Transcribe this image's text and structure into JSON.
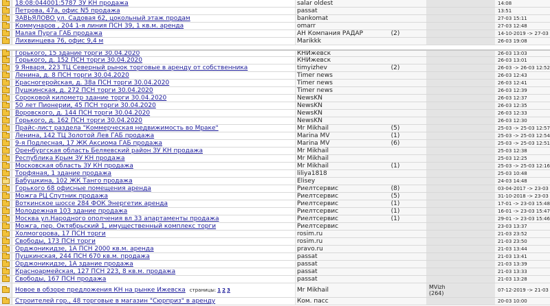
{
  "rows": [
    {
      "topic": "18:08:044001:5787 ЗУ КН продажа",
      "author": "salar oldest",
      "replies": "",
      "views": "",
      "date": "14:08",
      "read": false
    },
    {
      "topic": "Петрова, 47а, офис N5 продажа",
      "author": "passat",
      "replies": "",
      "views": "",
      "date": "13:51",
      "read": false
    },
    {
      "topic": "ЗАВЬЯЛОВО ул. Садовая 62, цокольный этаж продам",
      "author": "bankomat",
      "replies": "",
      "views": "",
      "date": "27-03 15:11",
      "read": false
    },
    {
      "topic": "Коммунаров , 204 1-я линия ПСН 39, 1 кв.м. аренда",
      "author": "omarr",
      "replies": "",
      "views": "",
      "date": "27-03 12:48",
      "read": false
    },
    {
      "topic": "Малая Пурга ГАБ продажа",
      "author": "АН Компания РАДАР",
      "replies": "(2)",
      "views": "",
      "date": "14-10-2019 -> 27-03 12:03",
      "read": false
    },
    {
      "topic": "Лихвинцева 76, офис 9,4 м",
      "author": "Marikkk",
      "replies": "",
      "views": "",
      "date": "26-03 19:08",
      "read": false
    },
    {
      "topic": "Горького, 15 здание торги 30.04.2020",
      "author": "КНИжевск",
      "replies": "",
      "views": "",
      "date": "26-03 13:03",
      "read": false,
      "sep": true
    },
    {
      "topic": "Горького, д. 152 ПСН торги 30.04.2020",
      "author": "КНИжевск",
      "replies": "",
      "views": "",
      "date": "26-03 13:01",
      "read": false
    },
    {
      "topic": "9 Января, 223 ТЦ Северный рынок торговые в аренду от собственника",
      "author": "timyizhev",
      "replies": "(2)",
      "views": "",
      "date": "26-03 -> 26-03 12:52",
      "read": false
    },
    {
      "topic": "Ленина, д. 8 ПСН торги 30.04.2020",
      "author": "Timer news",
      "replies": "",
      "views": "",
      "date": "26-03 12:43",
      "read": false
    },
    {
      "topic": "Красногеройская, д. 38а ПСН торги 30.04.2020",
      "author": "Timer news",
      "replies": "",
      "views": "",
      "date": "26-03 12:41",
      "read": false
    },
    {
      "topic": "Пушкинская, д. 272 ПСН торги 30.04.2020",
      "author": "Timer news",
      "replies": "",
      "views": "",
      "date": "26-03 12:39",
      "read": false
    },
    {
      "topic": "Сороковой километр здание торги 30.04.2020",
      "author": "NewsKN",
      "replies": "",
      "views": "",
      "date": "26-03 12:37",
      "read": false
    },
    {
      "topic": "50 лет Пионерии, 45 ПСН торги 30.04.2020",
      "author": "NewsKN",
      "replies": "",
      "views": "",
      "date": "26-03 12:35",
      "read": false
    },
    {
      "topic": "Воровского, д. 144 ПСН торги 30.04.2020",
      "author": "NewsKN",
      "replies": "",
      "views": "",
      "date": "26-03 12:33",
      "read": false
    },
    {
      "topic": "Горького, д. 162 ПСН торги 30.04.2020",
      "author": "NewsKN",
      "replies": "",
      "views": "",
      "date": "26-03 12:30",
      "read": false
    },
    {
      "topic": "Прайс-лист раздела \"Коммерческая недвижимость во Мраке\"",
      "author": "Mr Mikhail",
      "replies": "(5)",
      "views": "",
      "date": "25-03 -> 25-03 12:57",
      "read": false
    },
    {
      "topic": "Ленина, 142 ТЦ Золотой Лев ГАБ продажа",
      "author": "Marina MV",
      "replies": "(1)",
      "views": "",
      "date": "25-03 -> 25-03 12:54",
      "read": false
    },
    {
      "topic": "9-я Подлесная, 17 ЖК Аксиома ГАБ продажа",
      "author": "Marina MV",
      "replies": "(6)",
      "views": "",
      "date": "25-03 -> 25-03 12:51",
      "read": false
    },
    {
      "topic": "Оренбургская область Беляевский район ЗУ КН продажа",
      "author": "Mr Mikhail",
      "replies": "",
      "views": "",
      "date": "25-03 12:38",
      "read": false
    },
    {
      "topic": "Республика Крым ЗУ КН продажа",
      "author": "Mr Mikhail",
      "replies": "",
      "views": "",
      "date": "25-03 12:25",
      "read": false
    },
    {
      "topic": "Московская область ЗУ КН продажа",
      "author": "Mr Mikhail",
      "replies": "(1)",
      "views": "",
      "date": "25-03 -> 25-03 12:16",
      "read": false
    },
    {
      "topic": "Торфяная, 1 здание продажа",
      "author": "liliya1818",
      "replies": "",
      "views": "",
      "date": "25-03 10:48",
      "read": false
    },
    {
      "topic": "Бабушкина, 102 ЖК Танго продажа",
      "author": "Elisey",
      "replies": "",
      "views": "",
      "date": "24-03 14:48",
      "read": true
    },
    {
      "topic": "Горького 68 офисные помещения аренда",
      "author": "Риелтсервис",
      "replies": "(8)",
      "views": "",
      "date": "03-04-2017 -> 23-03 16:00",
      "read": false
    },
    {
      "topic": "Можга РЦ Спутник продажа",
      "author": "Риелтсервис",
      "replies": "(5)",
      "views": "",
      "date": "31-10-2018 -> 23-03 15:56",
      "read": false
    },
    {
      "topic": "Воткинское шоссе 284 ФОК Энергетик аренда",
      "author": "Риелтсервис",
      "replies": "(1)",
      "views": "",
      "date": "17-01 -> 23-03 15:48",
      "read": false
    },
    {
      "topic": "Молодежная 103 здание продажа",
      "author": "Риелтсервис",
      "replies": "(1)",
      "views": "",
      "date": "16-01 -> 23-03 15:47",
      "read": false
    },
    {
      "topic": "Москва ул.Народного ополчения вл 33 апартаменты продажа",
      "author": "Риелтсервис",
      "replies": "(1)",
      "views": "",
      "date": "29-01 -> 23-03 15:46",
      "read": false
    },
    {
      "topic": "Можга, пер. Октябрьский 1, имущественный комплекс торги",
      "author": "Риелтсервис",
      "replies": "",
      "views": "",
      "date": "23-03 13:37",
      "read": false
    },
    {
      "topic": "Холмогорова, 17 ПСН торги",
      "author": "rosim.ru",
      "replies": "",
      "views": "",
      "date": "21-03 23:52",
      "read": false
    },
    {
      "topic": "Свободы, 173 ПСН торги",
      "author": "rosim.ru",
      "replies": "",
      "views": "",
      "date": "21-03 23:50",
      "read": false
    },
    {
      "topic": "Орджоникидзе, 1А ПСН 2000 кв.м. аренда",
      "author": "pravo.ru",
      "replies": "",
      "views": "",
      "date": "21-03 13:44",
      "read": false
    },
    {
      "topic": "Пушкинская, 244 ПСН 670 кв.м. продажа",
      "author": "passat",
      "replies": "",
      "views": "",
      "date": "21-03 13:41",
      "read": false
    },
    {
      "topic": "Орджоникидзе, 1А здание продажа",
      "author": "passat",
      "replies": "",
      "views": "",
      "date": "21-03 13:39",
      "read": false
    },
    {
      "topic": "Красноармейская, 127 ПСН 223, 8 кв.м. продажа",
      "author": "passat",
      "replies": "",
      "views": "",
      "date": "21-03 13:33",
      "read": false
    },
    {
      "topic": "Свободы, 167 ПСН продажа",
      "author": "passat",
      "replies": "",
      "views": "",
      "date": "21-03 13:28",
      "read": false
    },
    {
      "topic": "Новое в обзоре предложения КН на рынке Ижевска",
      "author": "Mr Mikhail",
      "replies": "",
      "views": "MVizh\n(264)",
      "date": "07-12-2019 -> 21-03 00:52",
      "read": false,
      "pages_label": "страницы:",
      "pages": [
        "1",
        "2",
        "3"
      ],
      "tall": true
    },
    {
      "topic": "Строителей гор., 48 торговые в магазин \"Сюрприз\" в аренду",
      "author": "Ком. пасс",
      "replies": "",
      "views": "",
      "date": "20-03 10:00",
      "read": false
    }
  ]
}
